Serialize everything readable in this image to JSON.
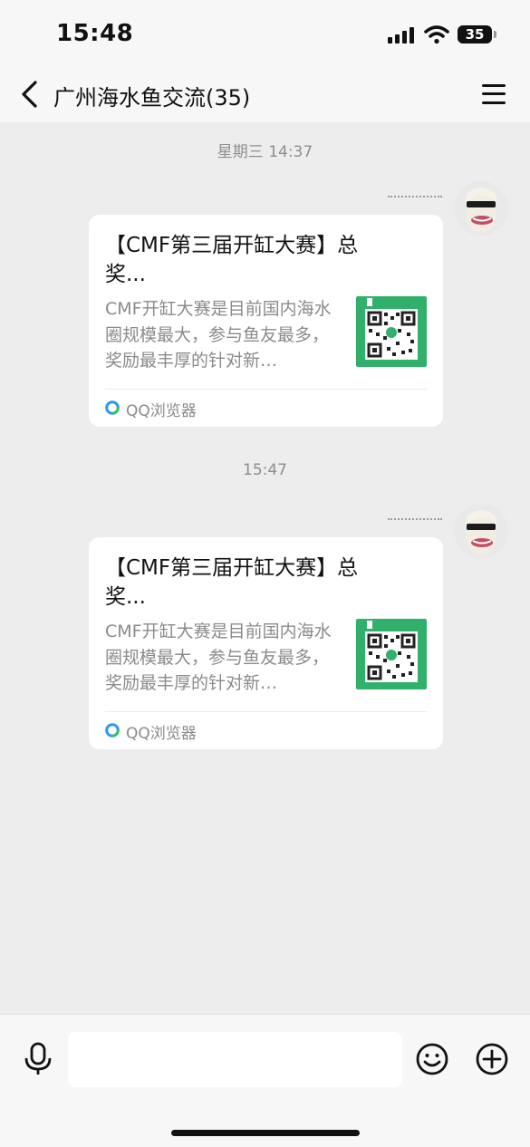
{
  "status_bar": {
    "time": "15:48",
    "battery": "35"
  },
  "header": {
    "title": "广州海水鱼交流(35)"
  },
  "messages": [
    {
      "timestamp": "星期三 14:37",
      "card": {
        "title": "【CMF第三届开缸大赛】总奖...",
        "description": "CMF开缸大赛是目前国内海水圈规模最大，参与鱼友最多，奖励最丰厚的针对新…",
        "source": "QQ浏览器"
      }
    },
    {
      "timestamp": "15:47",
      "card": {
        "title": "【CMF第三届开缸大赛】总奖...",
        "description": "CMF开缸大赛是目前国内海水圈规模最大，参与鱼友最多，奖励最丰厚的针对新…",
        "source": "QQ浏览器"
      }
    }
  ],
  "input_bar": {
    "placeholder": ""
  },
  "icons": {
    "back": "chevron-left-icon",
    "menu": "menu-icon",
    "mic": "microphone-icon",
    "emoji": "smiley-icon",
    "plus": "plus-circle-icon",
    "source": "qq-browser-icon"
  },
  "colors": {
    "background": "#ededed",
    "card": "#ffffff",
    "thumbnail": "#30b06b",
    "muted_text": "#8b8b8b"
  }
}
